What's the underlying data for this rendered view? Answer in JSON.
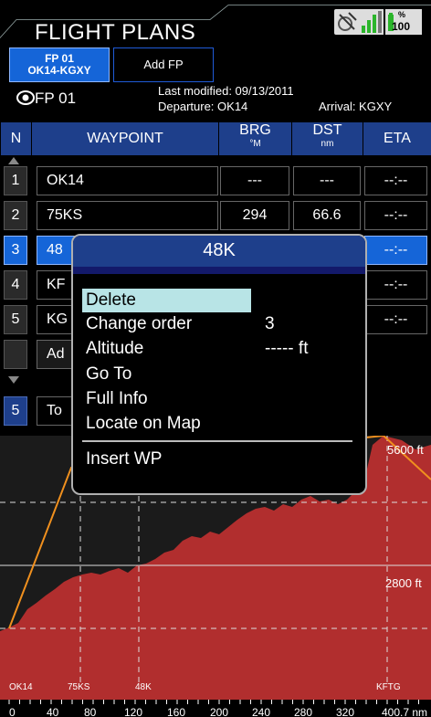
{
  "app": {
    "title": "FLIGHT PLANS"
  },
  "status": {
    "battery": "100",
    "battery_unit": "%"
  },
  "tabs": [
    {
      "line1": "FP 01",
      "line2": "OK14-KGXY"
    },
    {
      "label": "Add FP"
    }
  ],
  "plan": {
    "name": "FP 01",
    "last_modified": "Last modified: 09/13/2011",
    "departure": "Departure: OK14",
    "arrival": "Arrival: KGXY"
  },
  "columns": {
    "n": "N",
    "waypoint": "WAYPOINT",
    "brg": "BRG",
    "brg_unit": "°M",
    "dst": "DST",
    "dst_unit": "nm",
    "eta": "ETA"
  },
  "rows": [
    {
      "n": "1",
      "waypoint": "OK14",
      "brg": "---",
      "dst": "---",
      "eta": "--:--"
    },
    {
      "n": "2",
      "waypoint": "75KS",
      "brg": "294",
      "dst": "66.6",
      "eta": "--:--"
    },
    {
      "n": "3",
      "waypoint": "48",
      "eta": "--:--"
    },
    {
      "n": "4",
      "waypoint": "KF",
      "eta": "--:--"
    },
    {
      "n": "5",
      "waypoint": "KG",
      "eta": "--:--"
    },
    {
      "n": "",
      "waypoint": "Ad"
    },
    {
      "n": "5",
      "waypoint": "To"
    }
  ],
  "popup": {
    "title": "48K",
    "items": {
      "delete": "Delete",
      "change_order": "Change order",
      "change_order_value": "3",
      "altitude": "Altitude",
      "altitude_value": "----- ft",
      "goto": "Go To",
      "full_info": "Full Info",
      "locate": "Locate on Map",
      "insert": "Insert WP"
    }
  },
  "profile": {
    "alt_labels": {
      "high": "5600 ft",
      "mid": "2800 ft"
    },
    "waypoint_labels": {
      "wp1": "OK14",
      "wp2": "75KS",
      "wp3": "48K",
      "wp4": "KFTG"
    },
    "distance_ticks": [
      "0",
      "40",
      "80",
      "120",
      "160",
      "200",
      "240",
      "280",
      "320"
    ],
    "distance_end": "400.7 nm",
    "terrain_color": "#b12e2e",
    "route_color": "#f0901e"
  }
}
